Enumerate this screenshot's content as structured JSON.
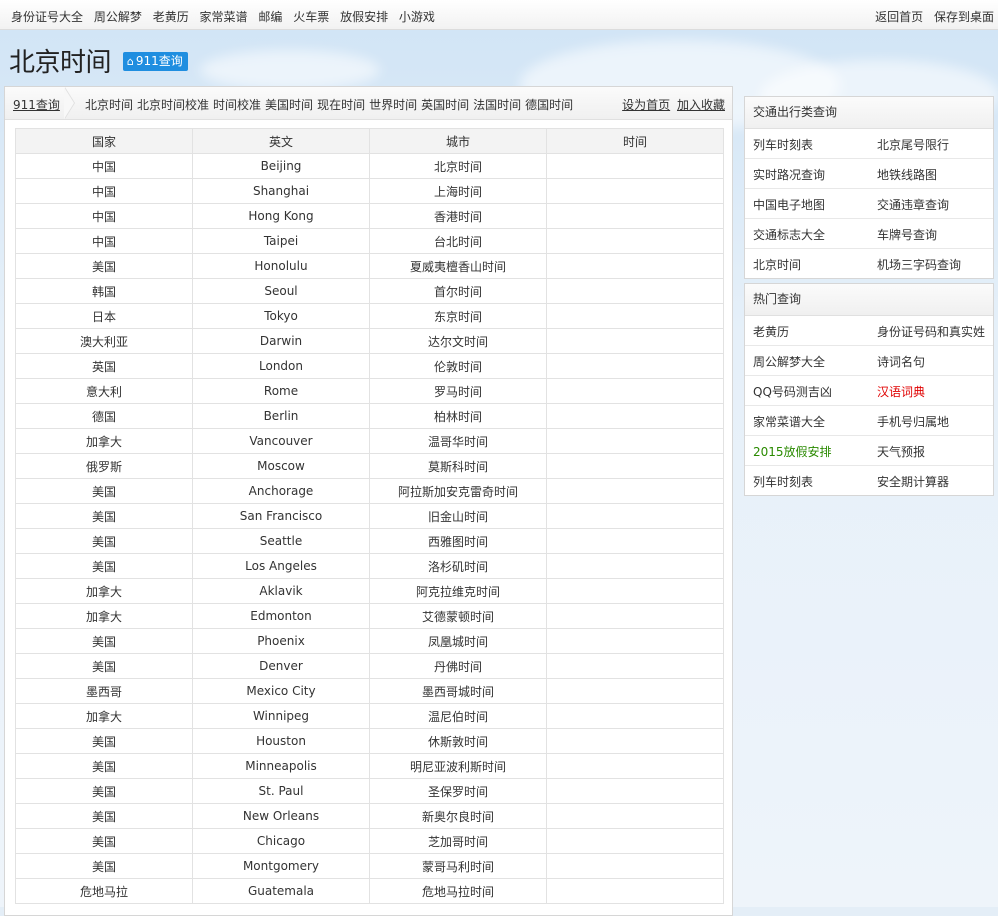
{
  "topnav": {
    "left_links": [
      "身份证号大全",
      "周公解梦",
      "老黄历",
      "家常菜谱",
      "邮编",
      "火车票",
      "放假安排",
      "小游戏"
    ],
    "right_links": [
      "返回首页",
      "保存到桌面"
    ]
  },
  "page": {
    "title": "北京时间",
    "badge": "911查询"
  },
  "breadcrumb": {
    "home": "911查询",
    "keywords": [
      "北京时间",
      "北京时间校准",
      "时间校准",
      "美国时间",
      "现在时间",
      "世界时间",
      "英国时间",
      "法国时间",
      "德国时间"
    ],
    "set_home": "设为首页",
    "add_favorite": "加入收藏"
  },
  "table": {
    "headers": [
      "国家",
      "英文",
      "城市",
      "时间"
    ],
    "rows": [
      [
        "中国",
        "Beijing",
        "北京时间",
        ""
      ],
      [
        "中国",
        "Shanghai",
        "上海时间",
        ""
      ],
      [
        "中国",
        "Hong Kong",
        "香港时间",
        ""
      ],
      [
        "中国",
        "Taipei",
        "台北时间",
        ""
      ],
      [
        "美国",
        "Honolulu",
        "夏威夷檀香山时间",
        ""
      ],
      [
        "韩国",
        "Seoul",
        "首尔时间",
        ""
      ],
      [
        "日本",
        "Tokyo",
        "东京时间",
        ""
      ],
      [
        "澳大利亚",
        "Darwin",
        "达尔文时间",
        ""
      ],
      [
        "英国",
        "London",
        "伦敦时间",
        ""
      ],
      [
        "意大利",
        "Rome",
        "罗马时间",
        ""
      ],
      [
        "德国",
        "Berlin",
        "柏林时间",
        ""
      ],
      [
        "加拿大",
        "Vancouver",
        "温哥华时间",
        ""
      ],
      [
        "俄罗斯",
        "Moscow",
        "莫斯科时间",
        ""
      ],
      [
        "美国",
        "Anchorage",
        "阿拉斯加安克雷奇时间",
        ""
      ],
      [
        "美国",
        "San Francisco",
        "旧金山时间",
        ""
      ],
      [
        "美国",
        "Seattle",
        "西雅图时间",
        ""
      ],
      [
        "美国",
        "Los Angeles",
        "洛杉矶时间",
        ""
      ],
      [
        "加拿大",
        "Aklavik",
        "阿克拉维克时间",
        ""
      ],
      [
        "加拿大",
        "Edmonton",
        "艾德蒙顿时间",
        ""
      ],
      [
        "美国",
        "Phoenix",
        "凤凰城时间",
        ""
      ],
      [
        "美国",
        "Denver",
        "丹佛时间",
        ""
      ],
      [
        "墨西哥",
        "Mexico City",
        "墨西哥城时间",
        ""
      ],
      [
        "加拿大",
        "Winnipeg",
        "温尼伯时间",
        ""
      ],
      [
        "美国",
        "Houston",
        "休斯敦时间",
        ""
      ],
      [
        "美国",
        "Minneapolis",
        "明尼亚波利斯时间",
        ""
      ],
      [
        "美国",
        "St. Paul",
        "圣保罗时间",
        ""
      ],
      [
        "美国",
        "New Orleans",
        "新奥尔良时间",
        ""
      ],
      [
        "美国",
        "Chicago",
        "芝加哥时间",
        ""
      ],
      [
        "美国",
        "Montgomery",
        "蒙哥马利时间",
        ""
      ],
      [
        "危地马拉",
        "Guatemala",
        "危地马拉时间",
        ""
      ]
    ]
  },
  "sidebar": {
    "traffic": {
      "title": "交通出行类查询",
      "rows": [
        [
          "列车时刻表",
          "北京尾号限行"
        ],
        [
          "实时路况查询",
          "地铁线路图"
        ],
        [
          "中国电子地图",
          "交通违章查询"
        ],
        [
          "交通标志大全",
          "车牌号查询"
        ],
        [
          "北京时间",
          "机场三字码查询"
        ]
      ]
    },
    "hot": {
      "title": "热门查询",
      "rows": [
        [
          "老黄历",
          "身份证号码和真实姓"
        ],
        [
          "周公解梦大全",
          "诗词名句"
        ],
        [
          "QQ号码测吉凶",
          "汉语词典"
        ],
        [
          "家常菜谱大全",
          "手机号归属地"
        ],
        [
          "2015放假安排",
          "天气预报"
        ],
        [
          "列车时刻表",
          "安全期计算器"
        ]
      ]
    },
    "colors": {
      "red_link": "#e00000",
      "green_link": "#2a8a00"
    }
  },
  "colors": {
    "badge_bg": "#1f8ee0",
    "border": "#d6d6d6"
  }
}
